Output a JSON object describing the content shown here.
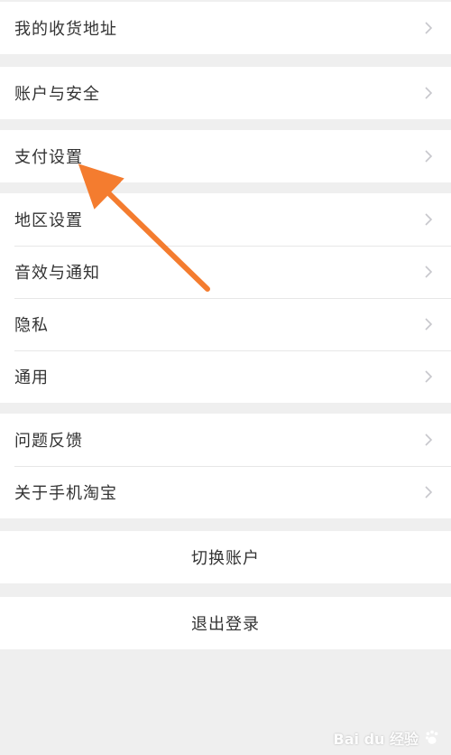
{
  "settings_groups": [
    {
      "items": [
        {
          "label": "我的收货地址"
        }
      ]
    },
    {
      "items": [
        {
          "label": "账户与安全"
        }
      ]
    },
    {
      "items": [
        {
          "label": "支付设置"
        }
      ]
    },
    {
      "items": [
        {
          "label": "地区设置"
        },
        {
          "label": "音效与通知"
        },
        {
          "label": "隐私"
        },
        {
          "label": "通用"
        }
      ]
    },
    {
      "items": [
        {
          "label": "问题反馈"
        },
        {
          "label": "关于手机淘宝"
        }
      ]
    }
  ],
  "actions": {
    "switch_account": "切换账户",
    "logout": "退出登录"
  },
  "watermark": {
    "text": "Bai du 经验"
  },
  "annotation": {
    "arrow_color": "#f47c2f",
    "arrow_target": "支付设置"
  }
}
